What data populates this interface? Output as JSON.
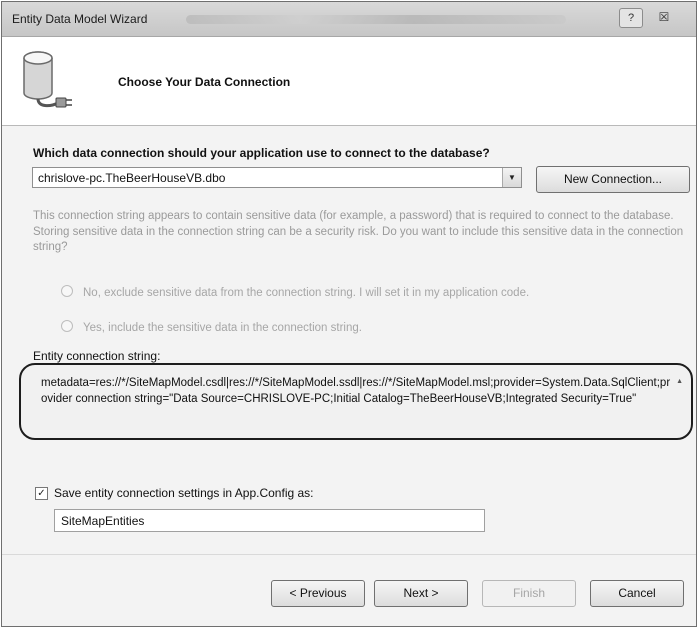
{
  "window": {
    "title": "Entity Data Model Wizard",
    "help_label": "?",
    "close_label": "☒"
  },
  "header": {
    "icon": "database-plug-icon",
    "title": "Choose Your Data Connection"
  },
  "connection": {
    "question": "Which data connection should your application use to connect to the database?",
    "selected": "chrislove-pc.TheBeerHouseVB.dbo",
    "new_connection_label": "New Connection..."
  },
  "warning": {
    "text": "This connection string appears to contain sensitive data (for example, a password) that is required to connect to the database. Storing sensitive data in the connection string can be a security risk. Do you want to include this sensitive data in the connection string?",
    "option_no": "No, exclude sensitive data from the connection string. I will set it in my application code.",
    "option_yes": "Yes, include the sensitive data in the connection string."
  },
  "entity_connection": {
    "label": "Entity connection string:",
    "value": "metadata=res://*/SiteMapModel.csdl|res://*/SiteMapModel.ssdl|res://*/SiteMapModel.msl;provider=System.Data.SqlClient;provider connection string=\"Data Source=CHRISLOVE-PC;Initial Catalog=TheBeerHouseVB;Integrated Security=True\""
  },
  "save_settings": {
    "checked": true,
    "label": "Save entity connection settings in App.Config as:",
    "value": "SiteMapEntities"
  },
  "buttons": {
    "previous": "< Previous",
    "next": "Next >",
    "finish": "Finish",
    "cancel": "Cancel"
  }
}
